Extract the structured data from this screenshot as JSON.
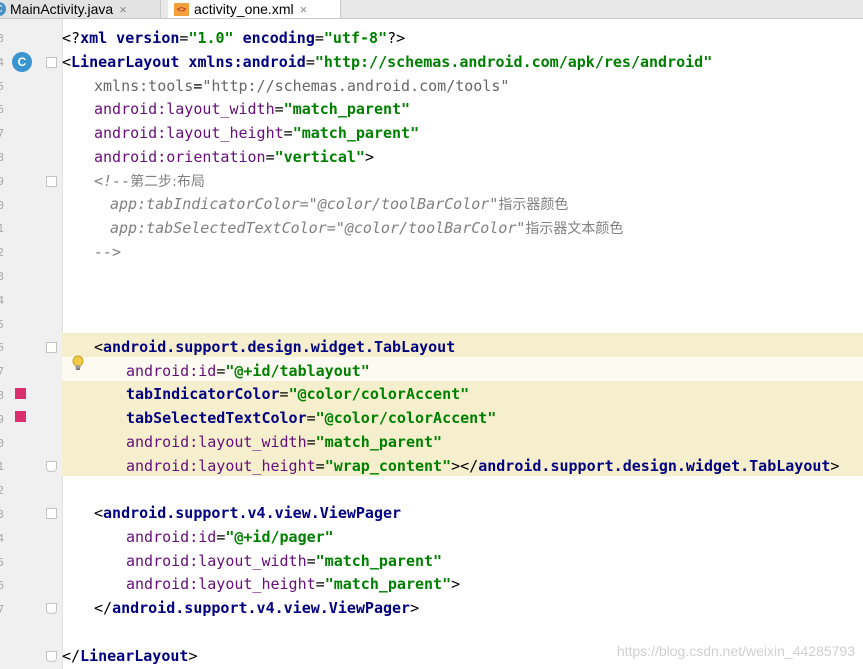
{
  "tabs": [
    {
      "label": "MainActivity.java",
      "icon": "java-class-icon",
      "icon_glyph": "C",
      "close": "×"
    },
    {
      "label": "activity_one.xml",
      "icon": "xml-file-icon",
      "icon_glyph": "<>",
      "close": "×"
    }
  ],
  "gutter": {
    "line_numbers": [
      "3",
      "4",
      "5",
      "6",
      "7",
      "8",
      "9",
      "0",
      "1",
      "2",
      "3",
      "4",
      "5",
      "6",
      "7",
      "8",
      "9",
      "0",
      "1",
      "2",
      "3",
      "4",
      "5",
      "6",
      "7"
    ],
    "class_badge": "C"
  },
  "code": {
    "l1": {
      "open": "<?",
      "tag": "xml",
      "a1": " version",
      "eq1": "=",
      "v1": "\"1.0\"",
      "a2": " encoding",
      "eq2": "=",
      "v2": "\"utf-8\"",
      "close": "?>"
    },
    "l2": {
      "open": "<",
      "tag": "LinearLayout",
      "a1": " xmlns:android",
      "eq": "=",
      "v": "\"http://schemas.android.com/apk/res/android\""
    },
    "l3": {
      "a": "xmlns:tools",
      "eq": "=",
      "v": "\"http://schemas.android.com/tools\""
    },
    "l4": {
      "a": "android:layout_width",
      "eq": "=",
      "v": "\"match_parent\""
    },
    "l5": {
      "a": "android:layout_height",
      "eq": "=",
      "v": "\"match_parent\""
    },
    "l6": {
      "a": "android:orientation",
      "eq": "=",
      "v": "\"vertical\"",
      "close": ">"
    },
    "c1": {
      "text": "<!--",
      "cjk": "第二步:布局"
    },
    "c2": {
      "text": "app:tabIndicatorColor=\"@color/toolBarColor\"",
      "cjk": "指示器颜色"
    },
    "c3": {
      "text": "app:tabSelectedTextColor=\"@color/toolBarColor\"",
      "cjk": "指示器文本颜色"
    },
    "c4": {
      "text": "-->"
    },
    "t1": {
      "open": "<",
      "tag": "android.support.design.widget.TabLayout"
    },
    "t2": {
      "a": "android:id",
      "eq": "=",
      "v": "\"@+id/tablayout\""
    },
    "t3": {
      "a": "tabIndicatorColor",
      "eq": "=",
      "v": "\"@color/colorAccent\""
    },
    "t4": {
      "a": "tabSelectedTextColor",
      "eq": "=",
      "v": "\"@color/colorAccent\""
    },
    "t5": {
      "a": "android:layout_width",
      "eq": "=",
      "v": "\"match_parent\""
    },
    "t6": {
      "a": "android:layout_height",
      "eq": "=",
      "v": "\"wrap_content\"",
      "close": "></",
      "tag": "android.support.design.widget.TabLayout",
      "end": ">"
    },
    "v1": {
      "open": "<",
      "tag": "android.support.v4.view.ViewPager"
    },
    "v2": {
      "a": "android:id",
      "eq": "=",
      "v": "\"@+id/pager\""
    },
    "v3": {
      "a": "android:layout_width",
      "eq": "=",
      "v": "\"match_parent\""
    },
    "v4": {
      "a": "android:layout_height",
      "eq": "=",
      "v": "\"match_parent\"",
      "close": ">"
    },
    "v5": {
      "open": "</",
      "tag": "android.support.v4.view.ViewPager",
      "close": ">"
    },
    "end": {
      "open": "</",
      "tag": "LinearLayout",
      "close": ">"
    }
  },
  "watermark": "https://blog.csdn.net/weixin_44285793",
  "colors": {
    "highlight": "#f6efcd",
    "tag": "#000080",
    "attr": "#660e7a",
    "value": "#008000",
    "comment": "#808080",
    "bookmark": "#d9306b"
  }
}
